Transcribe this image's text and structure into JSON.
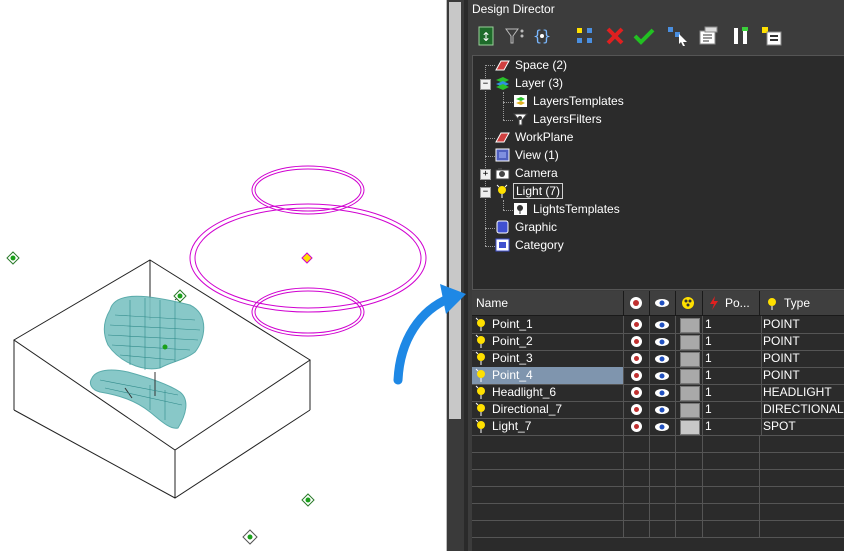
{
  "panel": {
    "title": "Design Director"
  },
  "toolbar": {
    "items": [
      {
        "icon": "refresh-icon"
      },
      {
        "icon": "filter-icon"
      },
      {
        "icon": "braces-icon"
      },
      {
        "icon": "select-all-icon"
      },
      {
        "icon": "delete-icon"
      },
      {
        "icon": "apply-check-icon"
      },
      {
        "icon": "pick-select-icon"
      },
      {
        "icon": "properties-icon"
      },
      {
        "icon": "tools-icon"
      },
      {
        "icon": "new-item-icon"
      }
    ]
  },
  "tree": {
    "nodes": [
      {
        "label": "Space (2)",
        "icon": "space-icon"
      },
      {
        "label": "Layer (3)",
        "icon": "layer-icon"
      },
      {
        "label": "LayersTemplates",
        "icon": "layers-templates-icon"
      },
      {
        "label": "LayersFilters",
        "icon": "layers-filters-icon"
      },
      {
        "label": "WorkPlane",
        "icon": "workplane-icon"
      },
      {
        "label": "View (1)",
        "icon": "view-icon"
      },
      {
        "label": "Camera",
        "icon": "camera-icon"
      },
      {
        "label": "Light (7)",
        "icon": "light-icon"
      },
      {
        "label": "LightsTemplates",
        "icon": "lights-templates-icon"
      },
      {
        "label": "Graphic",
        "icon": "graphic-icon"
      },
      {
        "label": "Category",
        "icon": "category-icon"
      }
    ]
  },
  "grid": {
    "columns": {
      "name": "Name",
      "power": "Po...",
      "type": "Type"
    },
    "rows": [
      {
        "name": "Point_1",
        "color": "#a9a9a9",
        "power": "1",
        "type": "POINT"
      },
      {
        "name": "Point_2",
        "color": "#a9a9a9",
        "power": "1",
        "type": "POINT"
      },
      {
        "name": "Point_3",
        "color": "#a9a9a9",
        "power": "1",
        "type": "POINT"
      },
      {
        "name": "Point_4",
        "color": "#a9a9a9",
        "power": "1",
        "type": "POINT"
      },
      {
        "name": "Headlight_6",
        "color": "#a9a9a9",
        "power": "1",
        "type": "HEADLIGHT"
      },
      {
        "name": "Directional_7",
        "color": "#a9a9a9",
        "power": "1",
        "type": "DIRECTIONAL"
      },
      {
        "name": "Light_7",
        "color": "#c8c8c8",
        "power": "1",
        "type": "SPOT"
      }
    ],
    "selected_row": "Point_4"
  },
  "colors": {
    "panel_bg": "#3c3c3c",
    "selection": "#7f95ae",
    "spot_light": "#d000d0",
    "chair": "#4aa3a3",
    "callout_arrow": "#1e88e5"
  }
}
